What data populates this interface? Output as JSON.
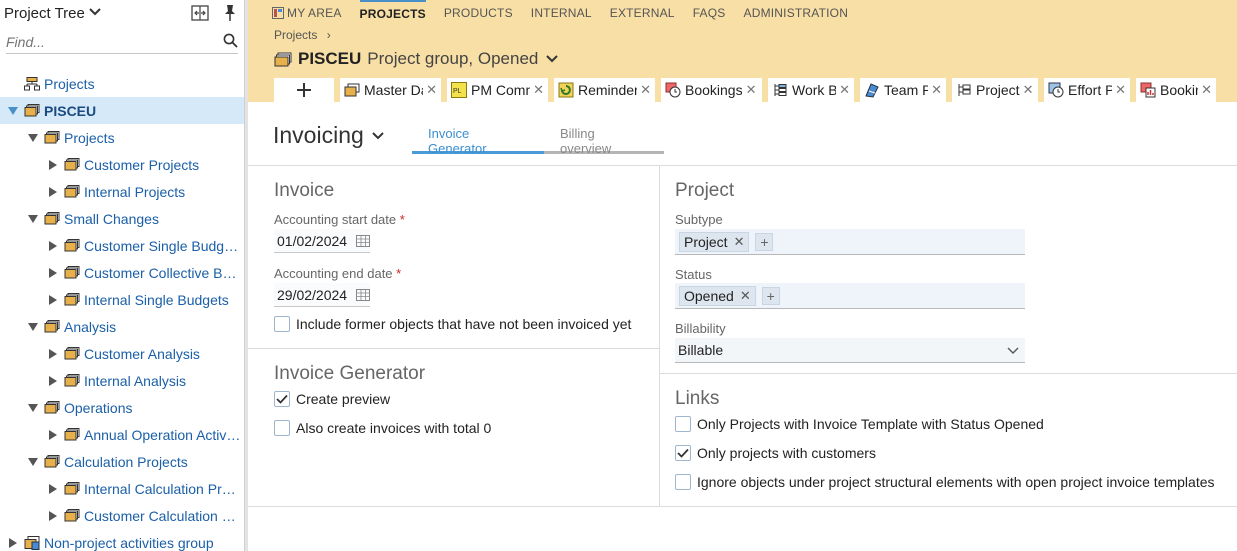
{
  "tree": {
    "title": "Project Tree",
    "search_placeholder": "Find...",
    "items": [
      {
        "label": "Projects",
        "level": 0,
        "toggle": "none",
        "icon": "project-tree-icon"
      },
      {
        "label": "PISCEU",
        "level": 0,
        "toggle": "open",
        "icon": "folder-icon",
        "selected": true
      },
      {
        "label": "Projects",
        "level": 1,
        "toggle": "open",
        "icon": "folder-icon"
      },
      {
        "label": "Customer Projects",
        "level": 2,
        "toggle": "closed",
        "icon": "folder-icon"
      },
      {
        "label": "Internal Projects",
        "level": 2,
        "toggle": "closed",
        "icon": "folder-icon"
      },
      {
        "label": "Small Changes",
        "level": 1,
        "toggle": "open",
        "icon": "folder-icon"
      },
      {
        "label": "Customer Single Budg…",
        "level": 2,
        "toggle": "closed",
        "icon": "folder-icon"
      },
      {
        "label": "Customer Collective B…",
        "level": 2,
        "toggle": "closed",
        "icon": "folder-icon"
      },
      {
        "label": "Internal Single Budgets",
        "level": 2,
        "toggle": "closed",
        "icon": "folder-icon"
      },
      {
        "label": "Analysis",
        "level": 1,
        "toggle": "open",
        "icon": "folder-icon"
      },
      {
        "label": "Customer Analysis",
        "level": 2,
        "toggle": "closed",
        "icon": "folder-icon"
      },
      {
        "label": "Internal Analysis",
        "level": 2,
        "toggle": "closed",
        "icon": "folder-icon"
      },
      {
        "label": "Operations",
        "level": 1,
        "toggle": "open",
        "icon": "folder-icon"
      },
      {
        "label": "Annual Operation Activ…",
        "level": 2,
        "toggle": "closed",
        "icon": "folder-icon"
      },
      {
        "label": "Calculation Projects",
        "level": 1,
        "toggle": "open",
        "icon": "folder-icon"
      },
      {
        "label": "Internal Calculation Pr…",
        "level": 2,
        "toggle": "closed",
        "icon": "folder-icon"
      },
      {
        "label": "Customer Calculation …",
        "level": 2,
        "toggle": "closed",
        "icon": "folder-icon"
      },
      {
        "label": "Non-project activities group",
        "level": 0,
        "toggle": "closed",
        "icon": "activities-folder-icon"
      }
    ]
  },
  "nav": {
    "items": [
      "MY AREA",
      "PROJECTS",
      "PRODUCTS",
      "INTERNAL",
      "EXTERNAL",
      "FAQS",
      "ADMINISTRATION"
    ],
    "active": "PROJECTS"
  },
  "breadcrumb": {
    "text": "Projects",
    "sep": "›"
  },
  "object": {
    "name": "PISCEU",
    "description": "Project group, Opened"
  },
  "tabs": [
    {
      "label": "Master Da",
      "icon": "master-data-icon"
    },
    {
      "label": "PM Comme",
      "icon": "pm-comments-icon"
    },
    {
      "label": "Reminder",
      "icon": "reminder-icon"
    },
    {
      "label": "Bookings",
      "icon": "bookings-icon"
    },
    {
      "label": "Work B",
      "icon": "work-breakdown-icon"
    },
    {
      "label": "Team P",
      "icon": "team-icon"
    },
    {
      "label": "Project",
      "icon": "project-structure-icon"
    },
    {
      "label": "Effort P",
      "icon": "effort-icon"
    },
    {
      "label": "Bookin",
      "icon": "booking-chart-icon"
    }
  ],
  "main": {
    "title": "Invoicing",
    "sub_tabs": {
      "active": "Invoice Generator",
      "inactive": "Billing overview"
    },
    "invoice": {
      "title": "Invoice",
      "start_label": "Accounting start date",
      "start_value": "01/02/2024",
      "end_label": "Accounting end date",
      "end_value": "29/02/2024",
      "required_mark": "*",
      "include_former": {
        "label": "Include former objects that have not been invoiced yet",
        "checked": false
      }
    },
    "generator": {
      "title": "Invoice Generator",
      "create_preview": {
        "label": "Create preview",
        "checked": true
      },
      "create_zero": {
        "label": "Also create invoices with total 0",
        "checked": false
      }
    },
    "project": {
      "title": "Project",
      "subtype_label": "Subtype",
      "subtype_tag": "Project",
      "status_label": "Status",
      "status_tag": "Opened",
      "billability_label": "Billability",
      "billability_value": "Billable"
    },
    "links": {
      "title": "Links",
      "opt1": {
        "label": "Only Projects with Invoice Template with Status Opened",
        "checked": false
      },
      "opt2": {
        "label": "Only projects with customers",
        "checked": true
      },
      "opt3": {
        "label": "Ignore objects under project structural elements with open project invoice templates",
        "checked": false
      }
    }
  }
}
